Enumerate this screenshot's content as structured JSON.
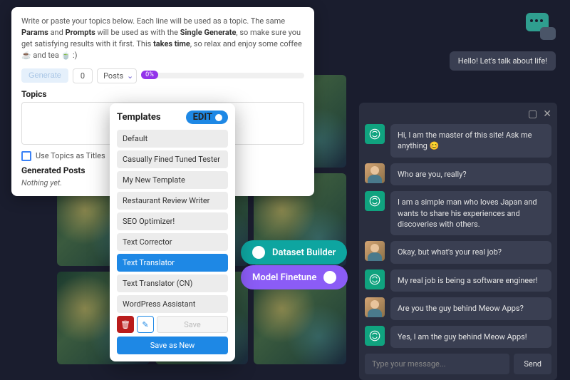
{
  "bulk": {
    "intro_a": "Write or paste your topics below. Each line will be used as a topic. The same ",
    "intro_params": "Params",
    "intro_and1": " and ",
    "intro_prompts": "Prompts",
    "intro_b": " will be used as with the ",
    "intro_single": "Single Generate",
    "intro_c": ", so make sure you get satisfying results with it first. This ",
    "intro_takes": "takes time",
    "intro_d": ", so relax and enjoy some coffee ☕ and tea 🍵 :)",
    "generate": "Generate",
    "count": "0",
    "select": "Posts",
    "percent": "0%",
    "topics_label": "Topics",
    "use_titles": "Use Topics as Titles",
    "generated_label": "Generated Posts",
    "nothing": "Nothing yet."
  },
  "templates": {
    "title": "Templates",
    "edit": "EDIT",
    "items": [
      "Default",
      "Casually Fined Tuned Tester",
      "My New Template",
      "Restaurant Review Writer",
      "SEO Optimizer!",
      "Text Corrector",
      "Text Translator",
      "Text Translator (CN)",
      "WordPress Assistant"
    ],
    "selected_index": 6,
    "save": "Save",
    "save_new": "Save as New"
  },
  "pills": {
    "dataset": "Dataset Builder",
    "finetune": "Model Finetune"
  },
  "chat": {
    "hello": "Hello! Let's talk about life!",
    "messages": [
      {
        "role": "bot",
        "text": "Hi, I am the master of this site! Ask me anything 😊"
      },
      {
        "role": "user",
        "text": "Who are you, really?"
      },
      {
        "role": "bot",
        "text": "I am a simple man who loves Japan and wants to share his experiences and discoveries with others."
      },
      {
        "role": "user",
        "text": "Okay, but what's your real job?"
      },
      {
        "role": "bot",
        "text": "My real job is being a software engineer!"
      },
      {
        "role": "user",
        "text": "Are you the guy behind Meow Apps?"
      },
      {
        "role": "bot",
        "text": "Yes, I am the guy behind Meow Apps!"
      }
    ],
    "placeholder": "Type your message...",
    "send": "Send"
  }
}
